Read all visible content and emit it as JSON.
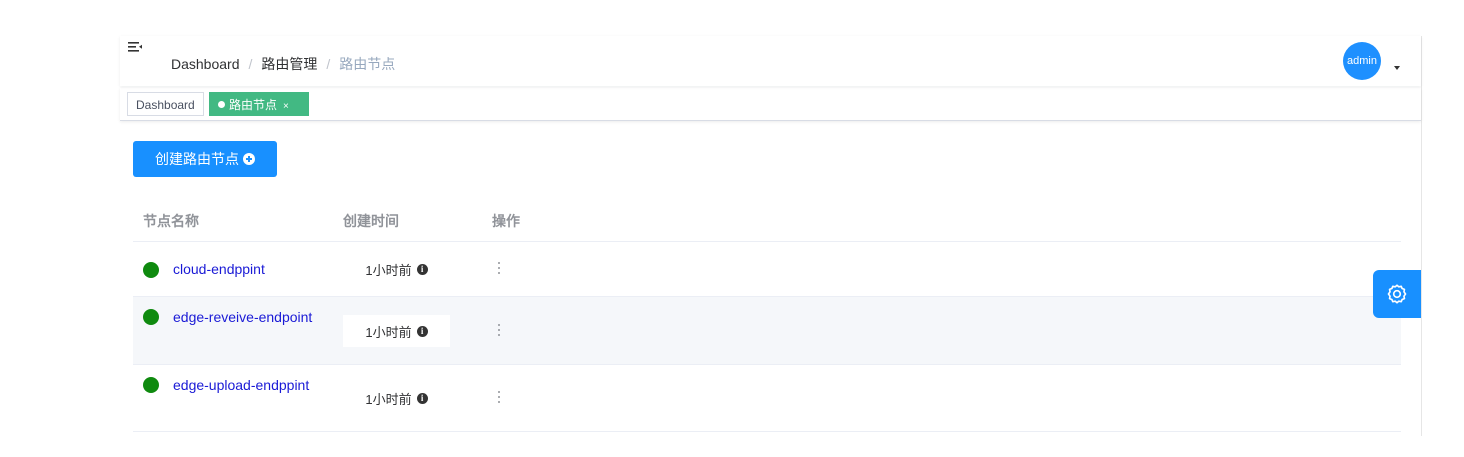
{
  "navbar": {
    "breadcrumb": [
      "Dashboard",
      "路由管理",
      "路由节点"
    ],
    "user": "admin"
  },
  "tags": {
    "items": [
      "Dashboard",
      "路由节点"
    ],
    "active_index": 1,
    "close_glyph": "×"
  },
  "toolbar": {
    "create_label": "创建路由节点"
  },
  "table": {
    "columns": [
      "节点名称",
      "创建时间",
      "操作"
    ],
    "rows": [
      {
        "name": "cloud-endppint",
        "status": "online",
        "created": "1小时前"
      },
      {
        "name": "edge-reveive-endpoint",
        "status": "online",
        "created": "1小时前"
      },
      {
        "name": "edge-upload-endppint",
        "status": "online",
        "created": "1小时前"
      }
    ]
  },
  "icons": {
    "hamburger": "menu-fold-icon",
    "info": "info-circle-icon",
    "more": "more-vertical-icon",
    "settings": "gear-icon",
    "create": "plus-circle-icon"
  },
  "colors": {
    "primary": "#1890ff",
    "tag_active": "#42b983",
    "status_online": "#0f8a0f",
    "link": "#1a1ad6"
  }
}
